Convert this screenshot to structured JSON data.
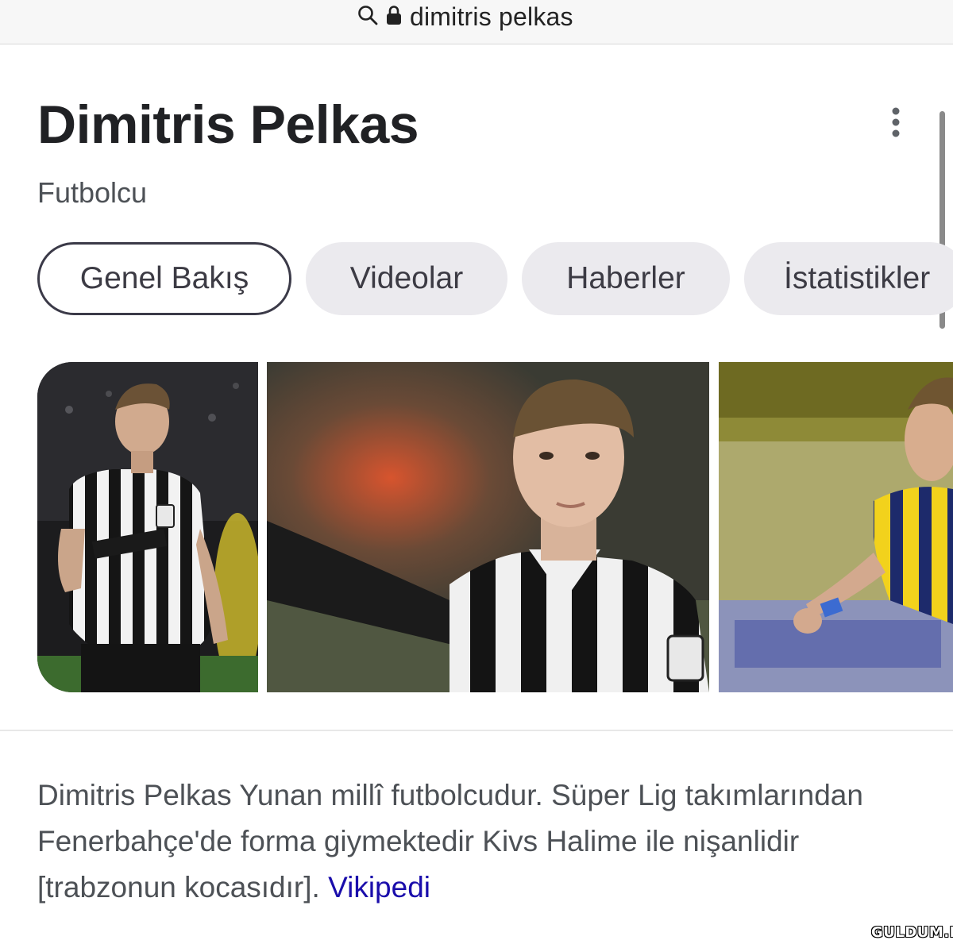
{
  "browser": {
    "url_text": "dimitris pelkas",
    "icons": [
      "search-icon",
      "lock-icon"
    ]
  },
  "panel": {
    "title": "Dimitris Pelkas",
    "subtitle": "Futbolcu",
    "menu_icon": "more-vert-icon"
  },
  "tabs": [
    {
      "label": "Genel Bakış",
      "active": true
    },
    {
      "label": "Videolar",
      "active": false
    },
    {
      "label": "Haberler",
      "active": false
    },
    {
      "label": "İstatistikler",
      "active": false
    }
  ],
  "images": [
    {
      "name": "player-photo-paok-1"
    },
    {
      "name": "player-photo-paok-2"
    },
    {
      "name": "player-photo-fenerbahce"
    }
  ],
  "description": {
    "text": "Dimitris Pelkas Yunan millî futbolcudur. Süper Lig takımlarından Fenerbahçe'de forma giymektedir Kivs Halime ile nişanlidir [trabzonun kocasıdır]. ",
    "link_label": "Vikipedi"
  },
  "watermark": "GULDUM.NET",
  "colors": {
    "title": "#202124",
    "subtitle": "#4d5156",
    "tab_bg": "#ebeaee",
    "tab_active_border": "#3b3a48",
    "link": "#1a0dab"
  }
}
